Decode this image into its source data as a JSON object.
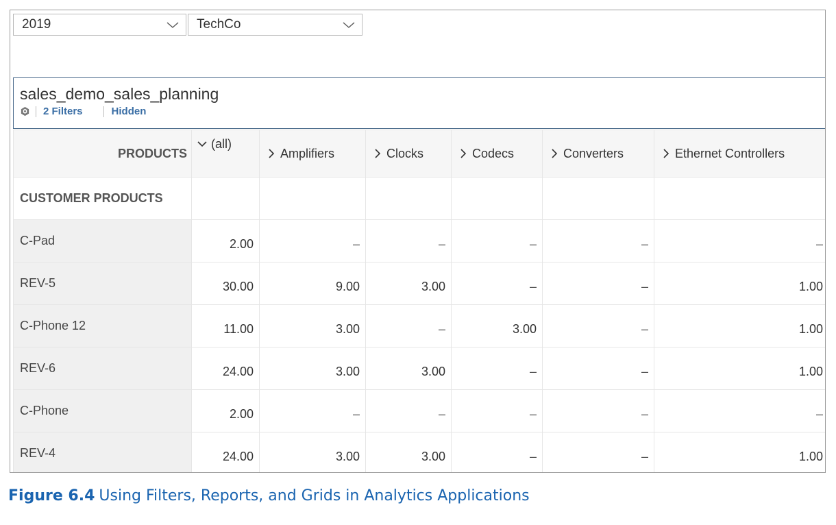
{
  "filters": {
    "year": {
      "value": "2019",
      "icon": "chevron-down-icon"
    },
    "company": {
      "value": "TechCo",
      "icon": "chevron-down-icon"
    }
  },
  "widget": {
    "title": "sales_demo_sales_planning",
    "filters_link": "2 Filters",
    "hidden_link": "Hidden",
    "icon": "cube-icon"
  },
  "grid": {
    "dimension_header": "PRODUCTS",
    "columns": [
      {
        "label": "(all)",
        "icon": "chevron-down-icon"
      },
      {
        "label": "Amplifiers",
        "icon": "chevron-right-icon"
      },
      {
        "label": "Clocks",
        "icon": "chevron-right-icon"
      },
      {
        "label": "Codecs",
        "icon": "chevron-right-icon"
      },
      {
        "label": "Converters",
        "icon": "chevron-right-icon"
      },
      {
        "label": "Ethernet Controllers",
        "icon": "chevron-right-icon"
      }
    ],
    "section_label": "CUSTOMER PRODUCTS",
    "rows": [
      {
        "label": "C-Pad",
        "cells": [
          "2.00",
          "–",
          "–",
          "–",
          "–",
          "–"
        ]
      },
      {
        "label": "REV-5",
        "cells": [
          "30.00",
          "9.00",
          "3.00",
          "–",
          "–",
          "1.00"
        ]
      },
      {
        "label": "C-Phone 12",
        "cells": [
          "11.00",
          "3.00",
          "–",
          "3.00",
          "–",
          "1.00"
        ]
      },
      {
        "label": "REV-6",
        "cells": [
          "24.00",
          "3.00",
          "3.00",
          "–",
          "–",
          "1.00"
        ]
      },
      {
        "label": "C-Phone",
        "cells": [
          "2.00",
          "–",
          "–",
          "–",
          "–",
          "–"
        ]
      },
      {
        "label": "REV-4",
        "cells": [
          "24.00",
          "3.00",
          "3.00",
          "–",
          "–",
          "1.00"
        ]
      }
    ]
  },
  "caption": {
    "figure": "Figure 6.4",
    "text": "Using Filters, Reports, and Grids in Analytics Applications"
  },
  "colors": {
    "accent": "#3a6ea5",
    "caption": "#1a64b0",
    "border": "#4e6e8e"
  }
}
